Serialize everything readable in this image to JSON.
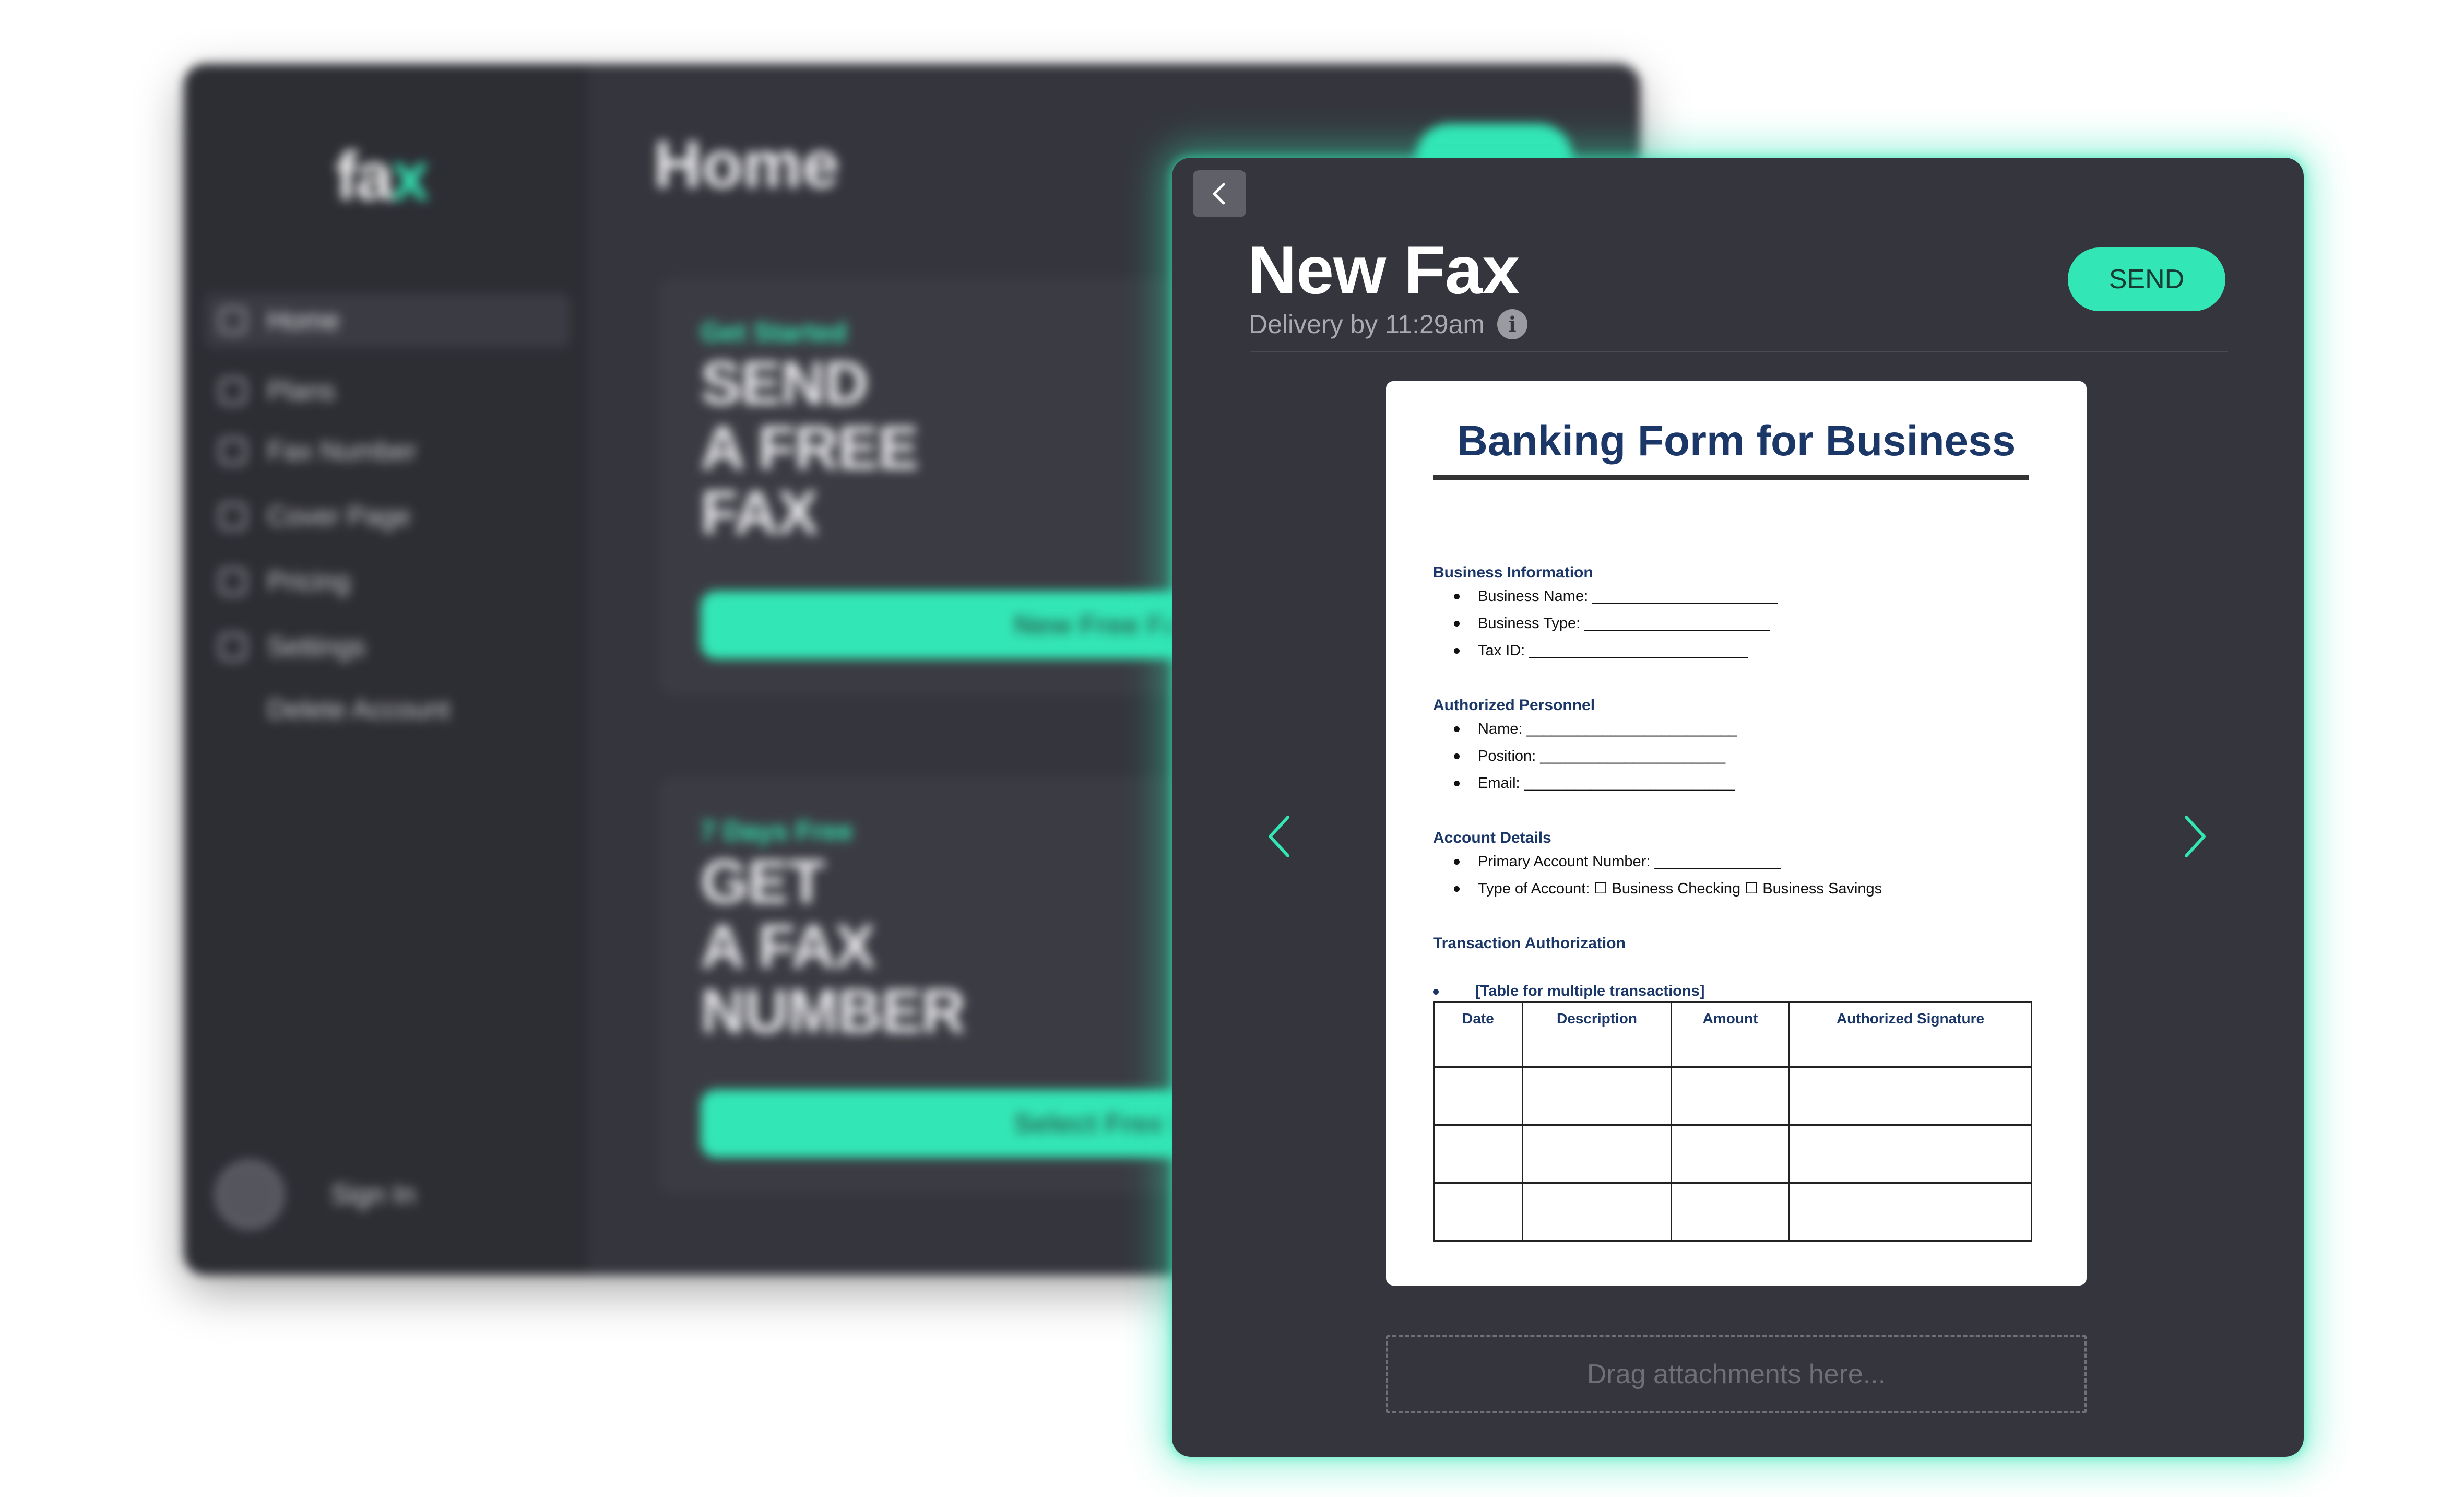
{
  "background_window": {
    "logo": "fa",
    "logo_accent": "x",
    "title": "Home",
    "nav": [
      {
        "label": "Home",
        "icon": "home-icon"
      },
      {
        "label": "Plans",
        "icon": "tag-icon"
      },
      {
        "label": "Fax Number",
        "icon": "fax-icon"
      },
      {
        "label": "Cover Page",
        "icon": "document-icon"
      },
      {
        "label": "Pricing",
        "icon": "price-icon"
      },
      {
        "label": "Settings",
        "icon": "gear-icon"
      },
      {
        "label": "Delete Account",
        "icon": ""
      }
    ],
    "sign_in": "Sign In",
    "cards": [
      {
        "kicker": "Get Started",
        "title_lines": [
          "SEND",
          "A FREE",
          "FAX"
        ],
        "button": "New Free Fax"
      },
      {
        "kicker": "7 Days Free",
        "title_lines": [
          "GET",
          "A FAX",
          "NUMBER"
        ],
        "button": "Select Free Number"
      }
    ]
  },
  "modal": {
    "title": "New Fax",
    "delivery": "Delivery by 11:29am",
    "info_glyph": "i",
    "send_label": "SEND",
    "drop_zone": "Drag attachments here..."
  },
  "document": {
    "title": "Banking Form for Business",
    "sections": [
      {
        "heading": "Business Information",
        "items": [
          "Business Name: ______________________",
          "Business Type: ______________________",
          "Tax ID: __________________________"
        ]
      },
      {
        "heading": "Authorized Personnel",
        "items": [
          "Name: _________________________",
          "Position: ______________________",
          "Email: _________________________"
        ]
      },
      {
        "heading": "Account Details",
        "items": [
          "Primary Account Number: _______________",
          "Type of Account: ☐ Business Checking ☐ Business Savings"
        ]
      },
      {
        "heading": "Transaction Authorization",
        "items": []
      }
    ],
    "table_note": "[Table for multiple transactions]",
    "table_headers": [
      "Date",
      "Description",
      "Amount",
      "Authorized Signature"
    ]
  },
  "colors": {
    "accent": "#33e6b6",
    "panel": "#35363d",
    "doc_heading": "#1b3768"
  }
}
